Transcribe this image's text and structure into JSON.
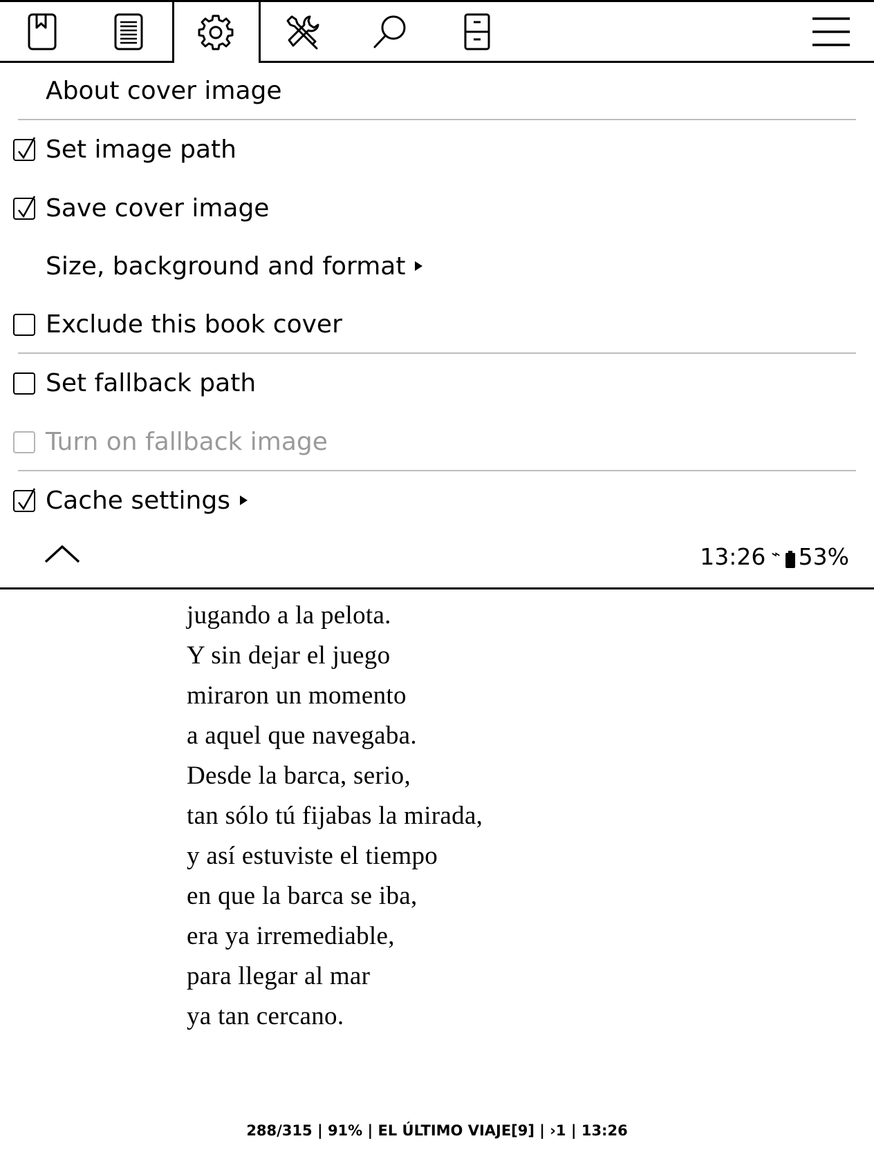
{
  "toolbar": {
    "icons": [
      {
        "name": "bookmark-icon",
        "title": "Navigation"
      },
      {
        "name": "document-icon",
        "title": "Typeset"
      },
      {
        "name": "gear-icon",
        "title": "Settings",
        "active": true
      },
      {
        "name": "tools-icon",
        "title": "Tools"
      },
      {
        "name": "search-icon",
        "title": "Search"
      },
      {
        "name": "file-cabinet-icon",
        "title": "Filemanager"
      },
      {
        "name": "hamburger-menu-icon",
        "title": "Main menu"
      }
    ]
  },
  "menu": {
    "about": "About cover image",
    "items": [
      {
        "label": "Set image path",
        "checked": true
      },
      {
        "label": "Save cover image",
        "checked": true
      },
      {
        "label": "Size, background and format",
        "submenu": true
      },
      {
        "label": "Exclude this book cover",
        "checked": false
      },
      {
        "label": "Set fallback path",
        "checked": false
      },
      {
        "label": "Turn on fallback image",
        "checked": false,
        "disabled": true
      },
      {
        "label": "Cache settings",
        "checked": true,
        "submenu": true
      }
    ]
  },
  "status": {
    "time": "13:26",
    "wifi_symbol": "⌁",
    "battery": "53%"
  },
  "reader": {
    "lines": [
      "jugando a la pelota.",
      "Y sin dejar el juego",
      "miraron un momento",
      "a aquel que navegaba.",
      "Desde la barca, serio,",
      "tan sólo tú fijabas la mirada,",
      "y así estuviste el tiempo",
      "en que la barca se iba,",
      "era ya irremediable,",
      "para llegar al mar",
      "ya tan cercano."
    ],
    "footer": "288/315 | 91% | EL ÚLTIMO VIAJE[9] | ›1 | 13:26"
  },
  "colors": {
    "text": "#000000",
    "disabled": "#9a9a9a",
    "separator": "#bdbdbd",
    "background": "#ffffff"
  }
}
